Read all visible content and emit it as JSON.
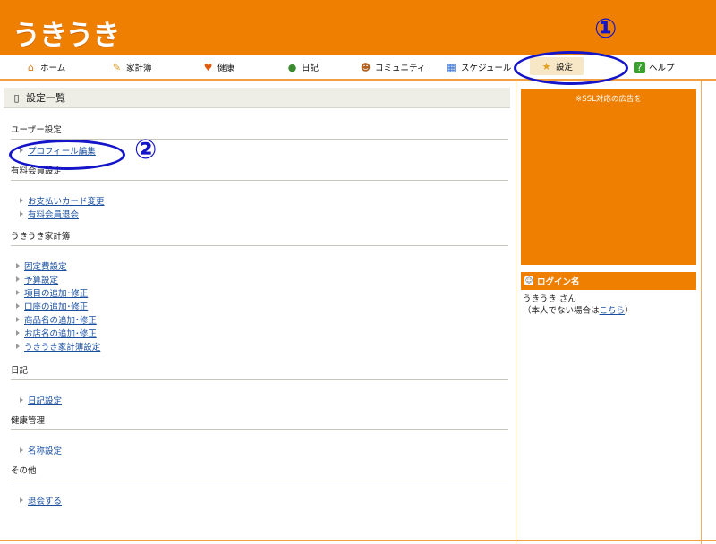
{
  "header": {
    "logo": "うきうき"
  },
  "nav": {
    "items": [
      {
        "label": "ホーム",
        "icon": "home-icon"
      },
      {
        "label": "家計簿",
        "icon": "pencil-icon"
      },
      {
        "label": "健康",
        "icon": "heart-icon"
      },
      {
        "label": "日記",
        "icon": "person-icon"
      },
      {
        "label": "コミュニティ",
        "icon": "community-icon"
      },
      {
        "label": "スケジュール",
        "icon": "calendar-icon"
      },
      {
        "label": "設定",
        "icon": "star-icon"
      },
      {
        "label": "ヘルプ",
        "icon": "help-icon"
      }
    ]
  },
  "main": {
    "title": "設定一覧",
    "sections": [
      {
        "heading": "ユーザー設定",
        "items": [
          "プロフィール編集"
        ]
      },
      {
        "heading": "有料会員設定",
        "items": [
          "お支払いカード変更",
          "有料会員退会"
        ]
      },
      {
        "heading": "うきうき家計簿",
        "items": [
          "固定費設定",
          "予算設定",
          "項目の追加･修正",
          "口座の追加･修正",
          "商品名の追加･修正",
          "お店名の追加･修正",
          "うきうき家計簿設定"
        ]
      },
      {
        "heading": "日記",
        "items": [
          "日記設定"
        ]
      },
      {
        "heading": "健康管理",
        "items": [
          "名称設定"
        ]
      },
      {
        "heading": "その他",
        "items": [
          "退会する"
        ]
      }
    ]
  },
  "sidebar": {
    "ad_text": "※SSL対応の広告を",
    "login_heading": "ログイン名",
    "user": "うきうき さん",
    "not_you_prefix": "（本人でない場合は",
    "not_you_link": "こちら",
    "not_you_suffix": "）"
  },
  "annotations": {
    "one": "①",
    "two": "②"
  },
  "colors": {
    "brand": "#ee7f00",
    "annotation": "#1414c8",
    "link": "#1a4fa0"
  }
}
